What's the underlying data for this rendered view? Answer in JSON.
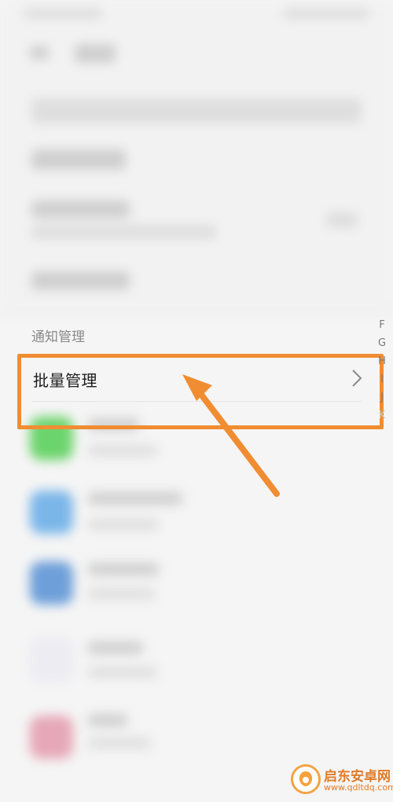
{
  "section": {
    "notification_header": "通知管理"
  },
  "batch_row": {
    "label": "批量管理"
  },
  "alpha_index": [
    "F",
    "G",
    "H",
    "I",
    "J",
    "K"
  ],
  "watermark": {
    "title": "启东安卓网",
    "url": "www.qdltdq.com"
  },
  "colors": {
    "highlight": "#f08d32",
    "watermark": "#e37b27"
  }
}
